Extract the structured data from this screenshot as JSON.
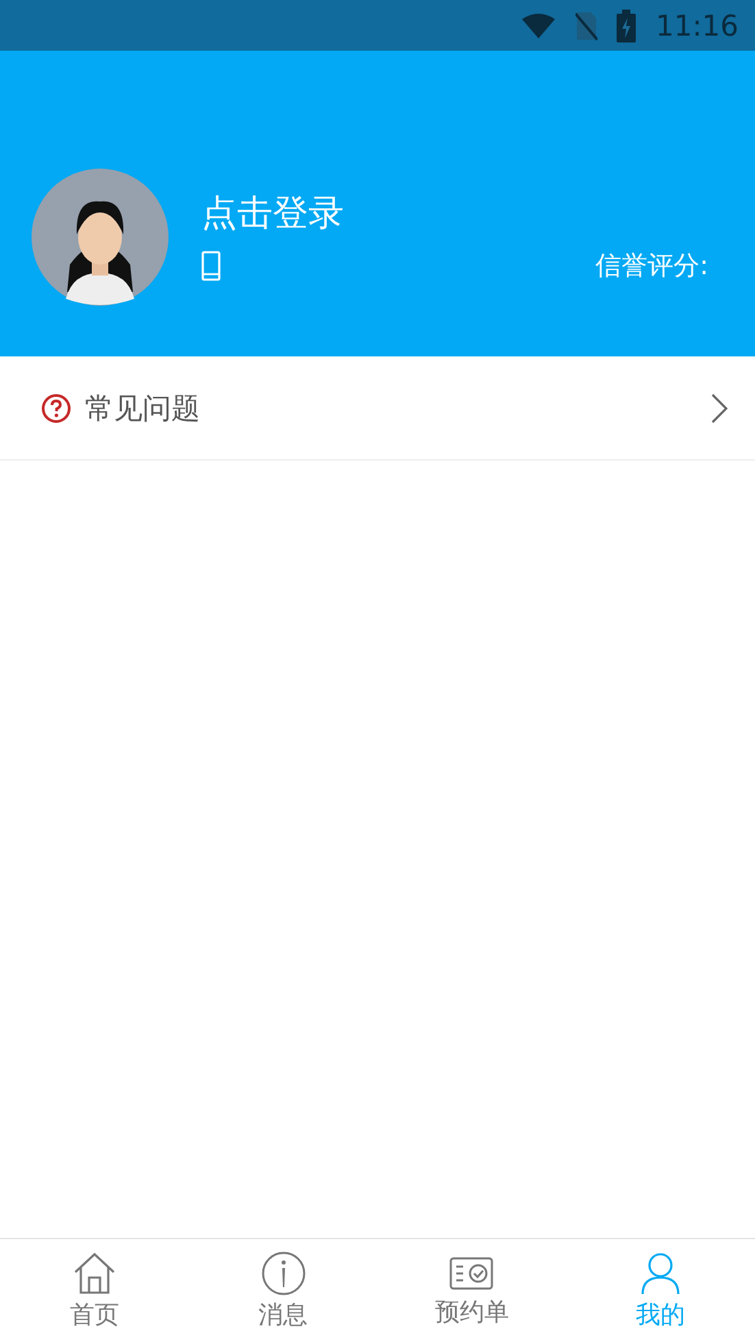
{
  "status_bar": {
    "time": "11:16"
  },
  "profile": {
    "login_text": "点击登录",
    "credit_label": "信誉评分:"
  },
  "menu": [
    {
      "kind": "help",
      "label": "常见问题"
    }
  ],
  "tabs": [
    {
      "kind": "home",
      "label": "首页",
      "selected": false
    },
    {
      "kind": "info",
      "label": "消息",
      "selected": false
    },
    {
      "kind": "order",
      "label": "预约单",
      "selected": false
    },
    {
      "kind": "user",
      "label": "我的",
      "selected": true
    }
  ]
}
